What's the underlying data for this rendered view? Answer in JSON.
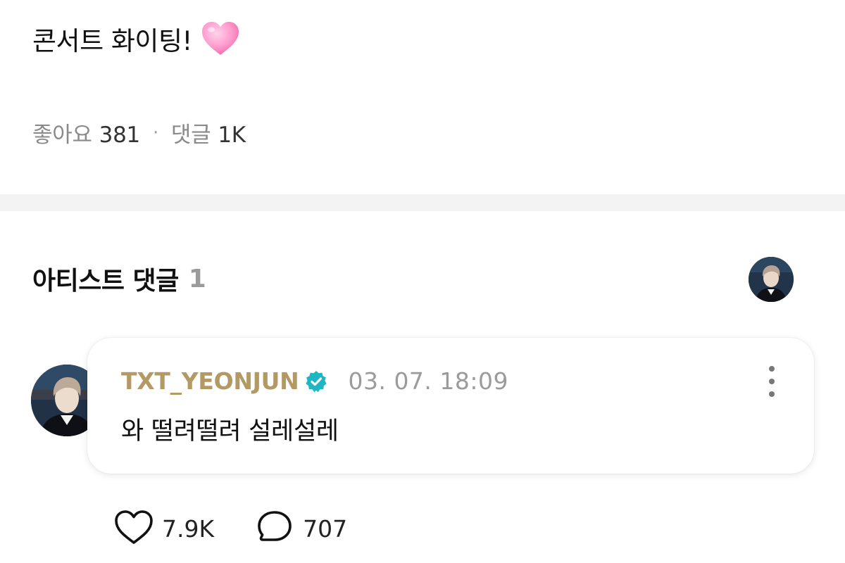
{
  "post": {
    "text": "콘서트 화이팅!",
    "emoji": "pink-heart-emoji",
    "likes_label": "좋아요",
    "likes_count": "381",
    "separator": "·",
    "comments_label": "댓글",
    "comments_count": "1K"
  },
  "artist_comments": {
    "title": "아티스트 댓글",
    "count": "1",
    "comment": {
      "author": "TXT_YEONJUN",
      "verified": true,
      "timestamp": "03. 07. 18:09",
      "text": "와 떨려떨려 설레설레",
      "likes": "7.9K",
      "replies": "707"
    }
  },
  "colors": {
    "author": "#b39a64",
    "verified_badge": "#1fb5c2",
    "divider": "#f3f3f3",
    "muted_text": "#8a8a8a",
    "heart_pink": "#ff9ed0"
  }
}
